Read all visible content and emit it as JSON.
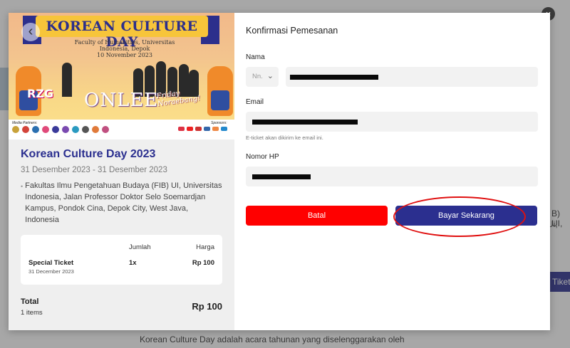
{
  "background": {
    "description_text": "Korean Culture Day adalah acara tahunan yang diselenggarakan oleh",
    "right_text_1": "B) UI,",
    "right_text_2": "Ui,",
    "tiket_button": "Tiket"
  },
  "modal": {
    "close_glyph": "×",
    "poster": {
      "back_glyph": "‹",
      "banner_title": "KOREAN CULTURE DAY",
      "subline_1": "Faculty of Humanities, Universitas Indonesia, Depok",
      "subline_2": "10 November 2023",
      "performer_1": "RZG",
      "performer_2": "ONLEE",
      "performer_3_line1": "Friday",
      "performer_3_line2": "Noraebang!",
      "media_partners_label": "Media Partners:",
      "sponsors_label": "Sponsors:",
      "colors": {
        "banner": "#f7c53a",
        "banner_text": "#2c2f8c",
        "sky_top": "#f1b98a",
        "sky_bottom": "#fbe28e"
      }
    },
    "event": {
      "title": "Korean Culture Day 2023",
      "dates": "31 Desember 2023 - 31 Desember 2023",
      "address": "Fakultas Ilmu Pengetahuan Budaya (FIB) UI, Universitas Indonesia, Jalan Professor Doktor Selo Soemardjan Kampus, Pondok Cina, Depok City, West Java, Indonesia",
      "pin_glyph": "•"
    },
    "ticket_table": {
      "col_qty": "Jumlah",
      "col_price": "Harga",
      "rows": [
        {
          "name": "Special Ticket",
          "date": "31 December 2023",
          "qty": "1x",
          "price": "Rp 100"
        }
      ]
    },
    "total": {
      "label": "Total",
      "items": "1 items",
      "amount": "Rp 100"
    },
    "form": {
      "title": "Konfirmasi Pemesanan",
      "name_label": "Nama",
      "salutation": "Nn.",
      "salutation_chevron": "⌄",
      "email_label": "Email",
      "email_hint": "E-ticket akan dikirim ke email ini.",
      "phone_label": "Nomor HP",
      "cancel_label": "Batal",
      "pay_label": "Bayar Sekarang"
    },
    "colors": {
      "primary": "#2b2f8f",
      "danger": "#ff0000",
      "highlight_circle": "#e01010"
    }
  }
}
